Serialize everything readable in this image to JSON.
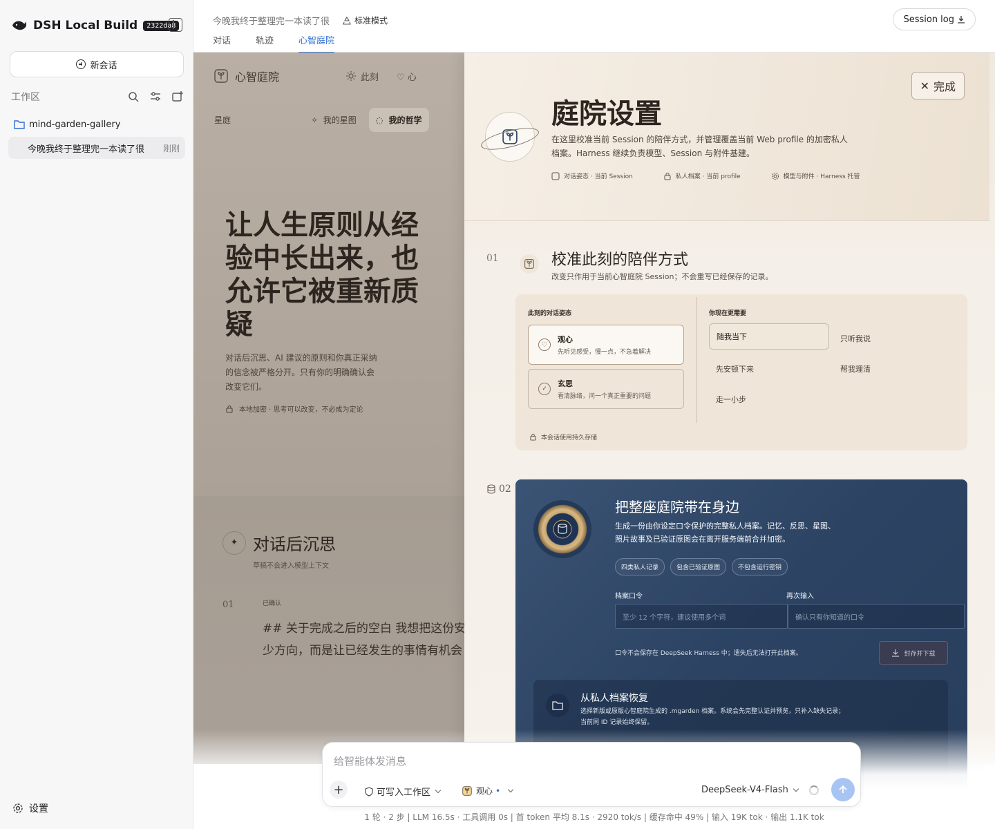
{
  "sidebar": {
    "app_name": "DSH Local Build",
    "build_hash": "2322da8",
    "new_chat_label": "新会话",
    "workspace_label": "工作区",
    "folder_name": "mind-garden-gallery",
    "session_title": "今晚我终于整理完一本读了很",
    "session_time": "刚刚",
    "settings_label": "设置"
  },
  "topbar": {
    "title": "今晚我终于整理完一本读了很",
    "mode": "标准模式",
    "tabs": [
      "对话",
      "轨迹",
      "心智庭院"
    ],
    "active_tab": "心智庭院",
    "session_log_label": "Session log"
  },
  "gallery": {
    "brand": "心智庭院",
    "nav_1": "此刻",
    "nav_2": "心",
    "section": "星庭",
    "sub_1": "我的星图",
    "sub_2": "我的哲学",
    "headline": "让人生原则从经验中长出来，也允许它被重新质疑",
    "description": "对话后沉思、AI 建议的原则和你真正采纳的信念被严格分开。只有你的明确确认会改变它们。",
    "lock_note": "本地加密 · 思考可以改变，不必成为定论",
    "reflection_title": "对话后沉思",
    "reflection_sub": "草稿不会进入模型上下文",
    "entry_num": "01",
    "entry_status": "已确认",
    "entry_body": "## 关于完成之后的空白 我想把这份安静留久一不是缺少方向，而是让已经发生的事情有机会"
  },
  "panel": {
    "done_label": "完成",
    "title": "庭院设置",
    "description": "在这里校准当前 Session 的陪伴方式，并管理覆盖当前 Web profile 的加密私人档案。Harness 继续负责模型、Session 与附件基建。",
    "meta": [
      "对话姿态 · 当前 Session",
      "私人档案 · 当前 profile",
      "模型与附件 · Harness 托管"
    ],
    "section1": {
      "num": "01",
      "title": "校准此刻的陪伴方式",
      "subtitle": "改变只作用于当前心智庭院 Session；不会重写已经保存的记录。",
      "left_label": "此刻的对话姿态",
      "options": [
        {
          "label": "观心",
          "sub": "先听见感受，慢一点，不急着解决"
        },
        {
          "label": "玄思",
          "sub": "看清脉络，问一个真正重要的问题"
        }
      ],
      "right_label": "你现在更需要",
      "needs": [
        "随我当下",
        "只听我说",
        "先安顿下来",
        "帮我理清",
        "走一小步"
      ],
      "footer": "本会话使用持久存储"
    },
    "section2": {
      "num": "02",
      "title": "把整座庭院带在身边",
      "description": "生成一份由你设定口令保护的完整私人档案。记忆、反思、星图、照片故事及已验证原图会在离开服务端前合并加密。",
      "chips": [
        "四类私人记录",
        "包含已验证原图",
        "不包含运行密钥"
      ],
      "pass_label": "档案口令",
      "pass_placeholder": "至少 12 个字符，建议使用多个词",
      "repeat_label": "再次输入",
      "repeat_placeholder": "确认只有你知道的口令",
      "note": "口令不会保存在 DeepSeek Harness 中；遗失后无法打开此档案。",
      "seal_label": "封存并下载",
      "restore_title": "从私人档案恢复",
      "restore_desc": "选择新版或原版心智庭院生成的 .mgarden 档案。系统会先完整认证并预览，只补入缺失记录；当前同 ID 记录始终保留。"
    }
  },
  "composer": {
    "placeholder": "给智能体发消息",
    "workspace_mode": "可写入工作区",
    "mode": "观心",
    "model": "DeepSeek-V4-Flash"
  },
  "status": {
    "text": "1 轮 · 2 步   |   LLM 16.5s · 工具调用 0s   |   首 token 平均 8.1s · 2920 tok/s   |   缓存命中 49%   |   输入 19K tok · 输出 1.1K tok"
  },
  "colors": {
    "accent": "#2f6fd6",
    "navy_card": "#2c4363",
    "gold": "#c9a872",
    "panel_bg": "#f4efe8"
  }
}
